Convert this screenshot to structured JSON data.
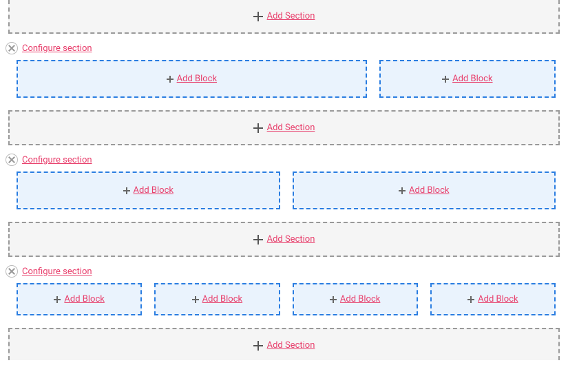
{
  "labels": {
    "add_section": "Add Section",
    "configure_section": "Configure section",
    "add_block": "Add Block"
  },
  "sections": [
    {
      "columns": [
        "2fr",
        "1fr"
      ]
    },
    {
      "columns": [
        "1fr",
        "1fr"
      ]
    },
    {
      "columns": [
        "1fr",
        "1fr",
        "1fr",
        "1fr"
      ]
    }
  ]
}
